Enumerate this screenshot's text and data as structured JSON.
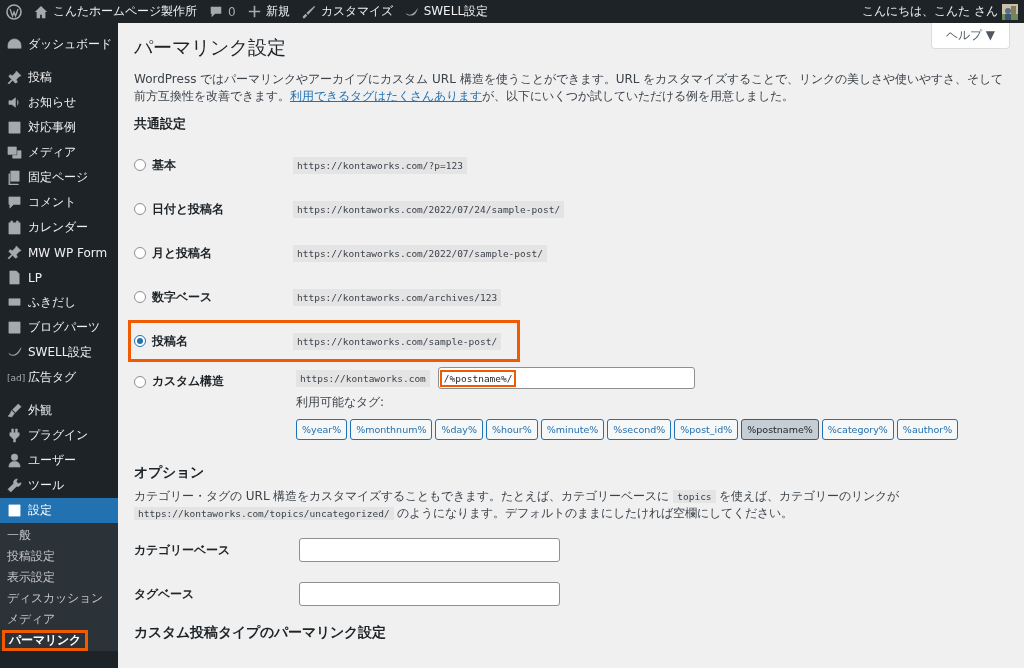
{
  "admin_bar": {
    "site_name": "こんたホームページ製作所",
    "comments": "0",
    "new": "新規",
    "customize": "カスタマイズ",
    "swell": "SWELL設定",
    "greeting": "こんにちは、こんた さん"
  },
  "sidebar": {
    "items": [
      {
        "label": "ダッシュボード",
        "selected": false
      },
      {
        "label": "投稿",
        "selected": false
      },
      {
        "label": "お知らせ",
        "selected": false
      },
      {
        "label": "対応事例",
        "selected": false
      },
      {
        "label": "メディア",
        "selected": false
      },
      {
        "label": "固定ページ",
        "selected": false
      },
      {
        "label": "コメント",
        "selected": false
      },
      {
        "label": "カレンダー",
        "selected": false
      },
      {
        "label": "MW WP Form",
        "selected": false
      },
      {
        "label": "LP",
        "selected": false
      },
      {
        "label": "ふきだし",
        "selected": false
      },
      {
        "label": "ブログパーツ",
        "selected": false
      },
      {
        "label": "SWELL設定",
        "selected": false
      },
      {
        "label": "広告タグ",
        "selected": false,
        "icon_text": "[ad]"
      },
      {
        "label": "外観",
        "selected": false
      },
      {
        "label": "プラグイン",
        "selected": false
      },
      {
        "label": "ユーザー",
        "selected": false
      },
      {
        "label": "ツール",
        "selected": false
      },
      {
        "label": "設定",
        "selected": true
      }
    ],
    "submenu": [
      {
        "label": "一般",
        "selected": false,
        "highlighted": false
      },
      {
        "label": "投稿設定",
        "selected": false,
        "highlighted": false
      },
      {
        "label": "表示設定",
        "selected": false,
        "highlighted": false
      },
      {
        "label": "ディスカッション",
        "selected": false,
        "highlighted": false
      },
      {
        "label": "メディア",
        "selected": false,
        "highlighted": false
      },
      {
        "label": "パーマリンク",
        "selected": true,
        "highlighted": true
      }
    ]
  },
  "help_button": "ヘルプ ▼",
  "page_title": "パーマリンク設定",
  "intro": {
    "before": "WordPress ではパーマリンクやアーカイブにカスタム URL 構造を使うことができます。URL をカスタマイズすることで、リンクの美しさや使いやすさ、そして前方互換性を改善できます。",
    "link": "利用できるタグはたくさんあります",
    "after": "が、以下にいくつか試していただける例を用意しました。"
  },
  "common_heading": "共通設定",
  "options": [
    {
      "label": "基本",
      "example": "https://kontaworks.com/?p=123",
      "selected": false,
      "highlighted": false
    },
    {
      "label": "日付と投稿名",
      "example": "https://kontaworks.com/2022/07/24/sample-post/",
      "selected": false,
      "highlighted": false
    },
    {
      "label": "月と投稿名",
      "example": "https://kontaworks.com/2022/07/sample-post/",
      "selected": false,
      "highlighted": false
    },
    {
      "label": "数字ベース",
      "example": "https://kontaworks.com/archives/123",
      "selected": false,
      "highlighted": false
    },
    {
      "label": "投稿名",
      "example": "https://kontaworks.com/sample-post/",
      "selected": true,
      "highlighted": true
    }
  ],
  "custom": {
    "label": "カスタム構造",
    "selected": false,
    "prefix": "https://kontaworks.com",
    "value": "/%postname%/",
    "highlighted": true,
    "tags_label": "利用可能なタグ:",
    "tags": [
      {
        "label": "%year%",
        "selected": false
      },
      {
        "label": "%monthnum%",
        "selected": false
      },
      {
        "label": "%day%",
        "selected": false
      },
      {
        "label": "%hour%",
        "selected": false
      },
      {
        "label": "%minute%",
        "selected": false
      },
      {
        "label": "%second%",
        "selected": false
      },
      {
        "label": "%post_id%",
        "selected": false
      },
      {
        "label": "%postname%",
        "selected": true
      },
      {
        "label": "%category%",
        "selected": false
      },
      {
        "label": "%author%",
        "selected": false
      }
    ]
  },
  "options_heading": "オプション",
  "options_desc": [
    {
      "kind": "text",
      "text": "カテゴリー・タグの URL 構造をカスタマイズすることもできます。たとえば、カテゴリーベースに "
    },
    {
      "kind": "code",
      "text": "topics"
    },
    {
      "kind": "text",
      "text": " を使えば、カテゴリーのリンクが "
    },
    {
      "kind": "code",
      "text": "https://kontaworks.com/topics/uncategorized/"
    },
    {
      "kind": "text",
      "text": " のようになります。デフォルトのままにしたければ空欄にしてください。"
    }
  ],
  "fields": [
    {
      "label": "カテゴリーベース"
    },
    {
      "label": "タグベース"
    }
  ],
  "cpt_heading": "カスタム投稿タイプのパーマリンク設定"
}
